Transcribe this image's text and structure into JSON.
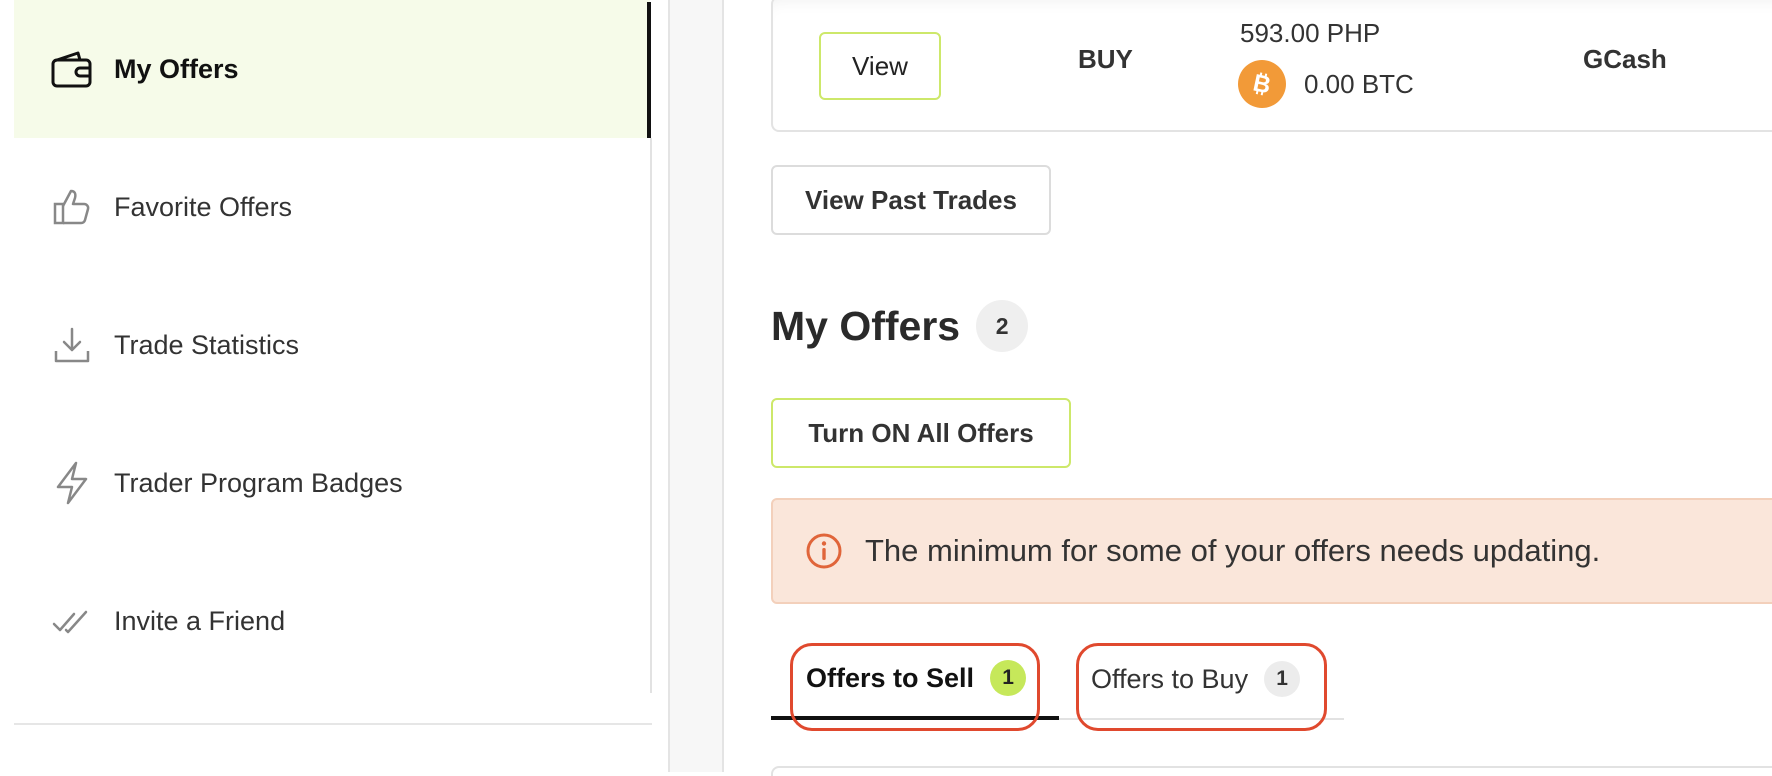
{
  "sidebar": {
    "items": [
      {
        "label": "My Offers",
        "icon": "wallet-icon",
        "active": true
      },
      {
        "label": "Favorite Offers",
        "icon": "thumbs-up-icon"
      },
      {
        "label": "Trade Statistics",
        "icon": "download-icon"
      },
      {
        "label": "Trader Program Badges",
        "icon": "lightning-icon"
      },
      {
        "label": "Invite a Friend",
        "icon": "double-check-icon"
      }
    ]
  },
  "trade_card": {
    "view_label": "View",
    "type": "BUY",
    "fiat_amount": "593.00 PHP",
    "crypto_amount": "0.00 BTC",
    "crypto_icon": "bitcoin-icon",
    "payment_method": "GCash"
  },
  "past_trades_label": "View Past Trades",
  "offers": {
    "heading": "My Offers",
    "count": "2",
    "turn_on_label": "Turn ON All Offers"
  },
  "alert": {
    "icon": "info-icon",
    "message": "The minimum for some of your offers needs updating."
  },
  "tabs": [
    {
      "label": "Offers to Sell",
      "count": "1",
      "active": true
    },
    {
      "label": "Offers to Buy",
      "count": "1",
      "active": false
    }
  ],
  "colors": {
    "accent_green": "#c6e85a",
    "active_bg": "#f6fbe9",
    "alert_bg": "#fae6da",
    "alert_icon": "#e0653a",
    "bitcoin": "#f29a38",
    "highlight": "#e0492e"
  }
}
